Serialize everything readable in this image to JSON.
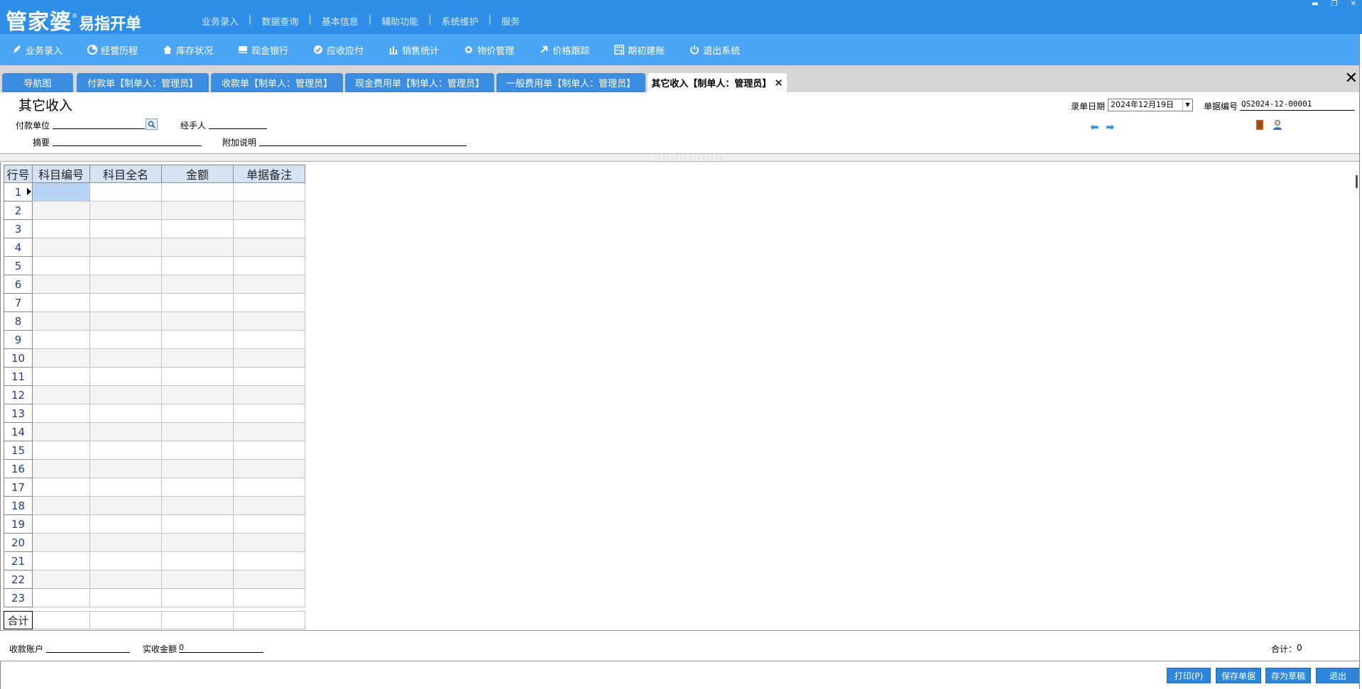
{
  "app": {
    "brand": "管家婆",
    "reg": "®",
    "subtitle": "易指开单",
    "top_menu": [
      "业务录入",
      "数据查询",
      "基本信息",
      "辅助功能",
      "系统维护",
      "服务"
    ],
    "window_controls": [
      "▬",
      "❐",
      "✕"
    ]
  },
  "toolbar": [
    {
      "label": "业务录入",
      "icon": "pen-icon"
    },
    {
      "label": "经营历程",
      "icon": "chart-pie-icon"
    },
    {
      "label": "库存状况",
      "icon": "house-icon"
    },
    {
      "label": "现金银行",
      "icon": "bank-card-icon"
    },
    {
      "label": "应收应付",
      "icon": "check-circle-icon"
    },
    {
      "label": "销售统计",
      "icon": "bar-chart-icon"
    },
    {
      "label": "物价管理",
      "icon": "gear-icon"
    },
    {
      "label": "价格跟踪",
      "icon": "arrow-up-right-icon"
    },
    {
      "label": "期初建账",
      "icon": "calculator-icon"
    },
    {
      "label": "退出系统",
      "icon": "power-icon"
    }
  ],
  "tabs": [
    {
      "label": "导航图"
    },
    {
      "label": "付款单【制单人：管理员】"
    },
    {
      "label": "收款单【制单人：管理员】"
    },
    {
      "label": "现金费用单【制单人：管理员】"
    },
    {
      "label": "一般费用单【制单人：管理员】"
    },
    {
      "label": "其它收入【制单人：管理员】",
      "active": true
    }
  ],
  "form": {
    "title": "其它收入",
    "payer_label": "付款单位",
    "handler_label": "经手人",
    "summary_label": "摘要",
    "note_label": "附加说明",
    "date_label": "录单日期",
    "date_value": "2024年12月19日",
    "billno_label": "单据编号",
    "billno_value": "QS2024-12-00001"
  },
  "grid": {
    "headers": [
      "行号",
      "科目编号",
      "科目全名",
      "金额",
      "单据备注"
    ],
    "rows": [
      "1",
      "2",
      "3",
      "4",
      "5",
      "6",
      "7",
      "8",
      "9",
      "10",
      "11",
      "12",
      "13",
      "14",
      "15",
      "16",
      "17",
      "18",
      "19",
      "20",
      "21",
      "22",
      "23"
    ],
    "total_label": "合计"
  },
  "footer": {
    "account_label": "收款账户",
    "actual_label": "实收金额",
    "actual_value": "0",
    "total_label": "合计：",
    "total_value": "0"
  },
  "buttons": {
    "print": "打印(P)",
    "save": "保存单据",
    "draft": "存为草稿",
    "exit": "退出"
  },
  "colors": {
    "titlebar": "#2f8ee8",
    "toolbar": "#4aa6f5",
    "tab": "#3a8de0",
    "button": "#2d86dc",
    "grid_header": "#d5e3f2",
    "selected_cell": "#b7d4f7"
  }
}
